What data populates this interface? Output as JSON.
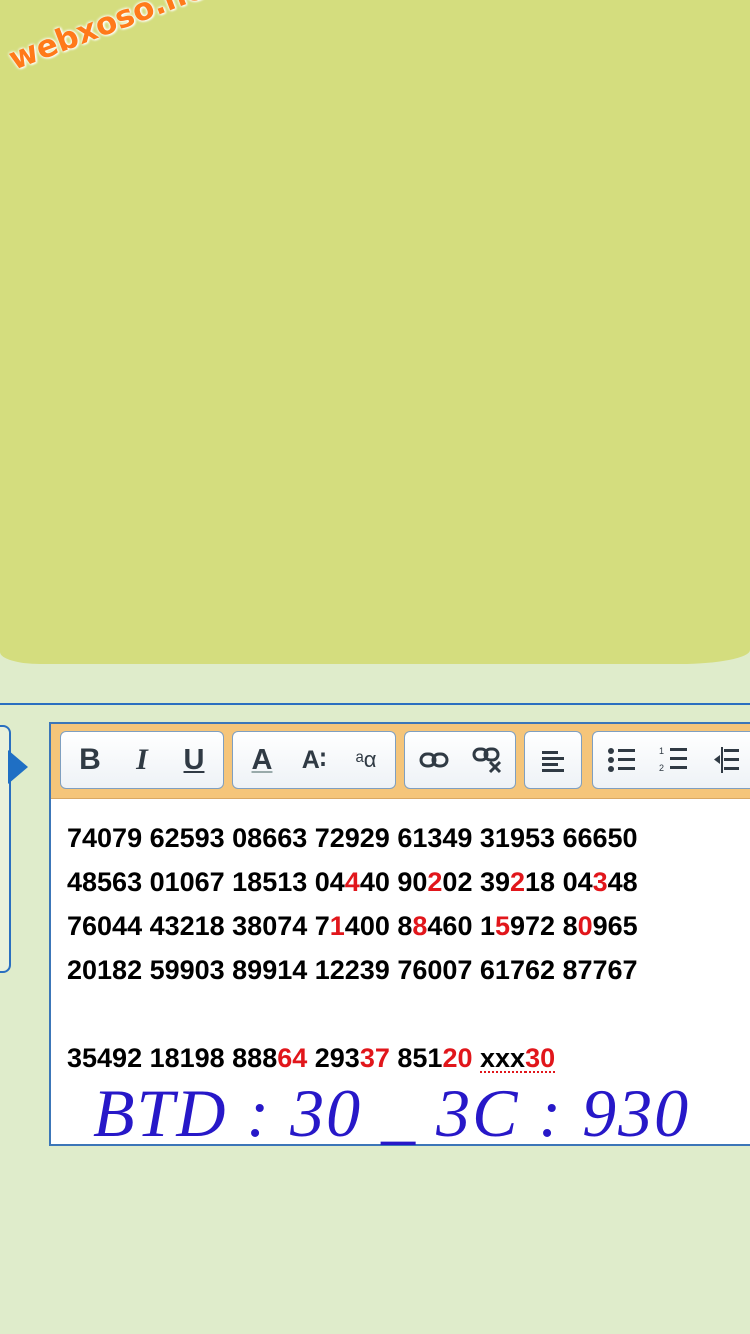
{
  "watermark": "webxoso.net",
  "toolbar": {
    "bold": "B",
    "italic": "I",
    "underline": "U",
    "font_color": "A",
    "font_size": "A∶",
    "font_family": "ᵃα"
  },
  "numbers": {
    "rows": [
      [
        {
          "t": "74079",
          "r": ""
        },
        {
          "t": " 62593",
          "r": ""
        },
        {
          "t": " 08663",
          "r": ""
        },
        {
          "t": " 72929",
          "r": ""
        },
        {
          "t": " 61349",
          "r": ""
        },
        {
          "t": " 31953",
          "r": ""
        },
        {
          "t": " 66650",
          "r": ""
        }
      ]
    ],
    "line1": "74079 62593 08663 72929 61349 31953 66650",
    "line2": [
      "48563 01067 18513 04",
      "4",
      "40 90",
      "2",
      "02 39",
      "2",
      "18 04",
      "3",
      "48"
    ],
    "line3": [
      "76044 43218 38074 7",
      "1",
      "400 8",
      "8",
      "460 1",
      "5",
      "972 8",
      "0",
      "965"
    ],
    "line4": "20182 59903 89914 12239 76007 61762 87767",
    "line5": [
      "35492 18198 888",
      "64",
      " 293",
      "37",
      " 851",
      "20",
      " ",
      "xxx",
      "30"
    ]
  },
  "handwriting": "BTD : 30 _ 3C : 930",
  "colors": {
    "top_panel": "#d4dd7e",
    "page_bg": "#dfeccb",
    "highlight_red": "#e1161b",
    "handwriting_blue": "#2718c8",
    "toolbar_bg": "#f5c57a",
    "border_blue": "#2a6fc0"
  }
}
